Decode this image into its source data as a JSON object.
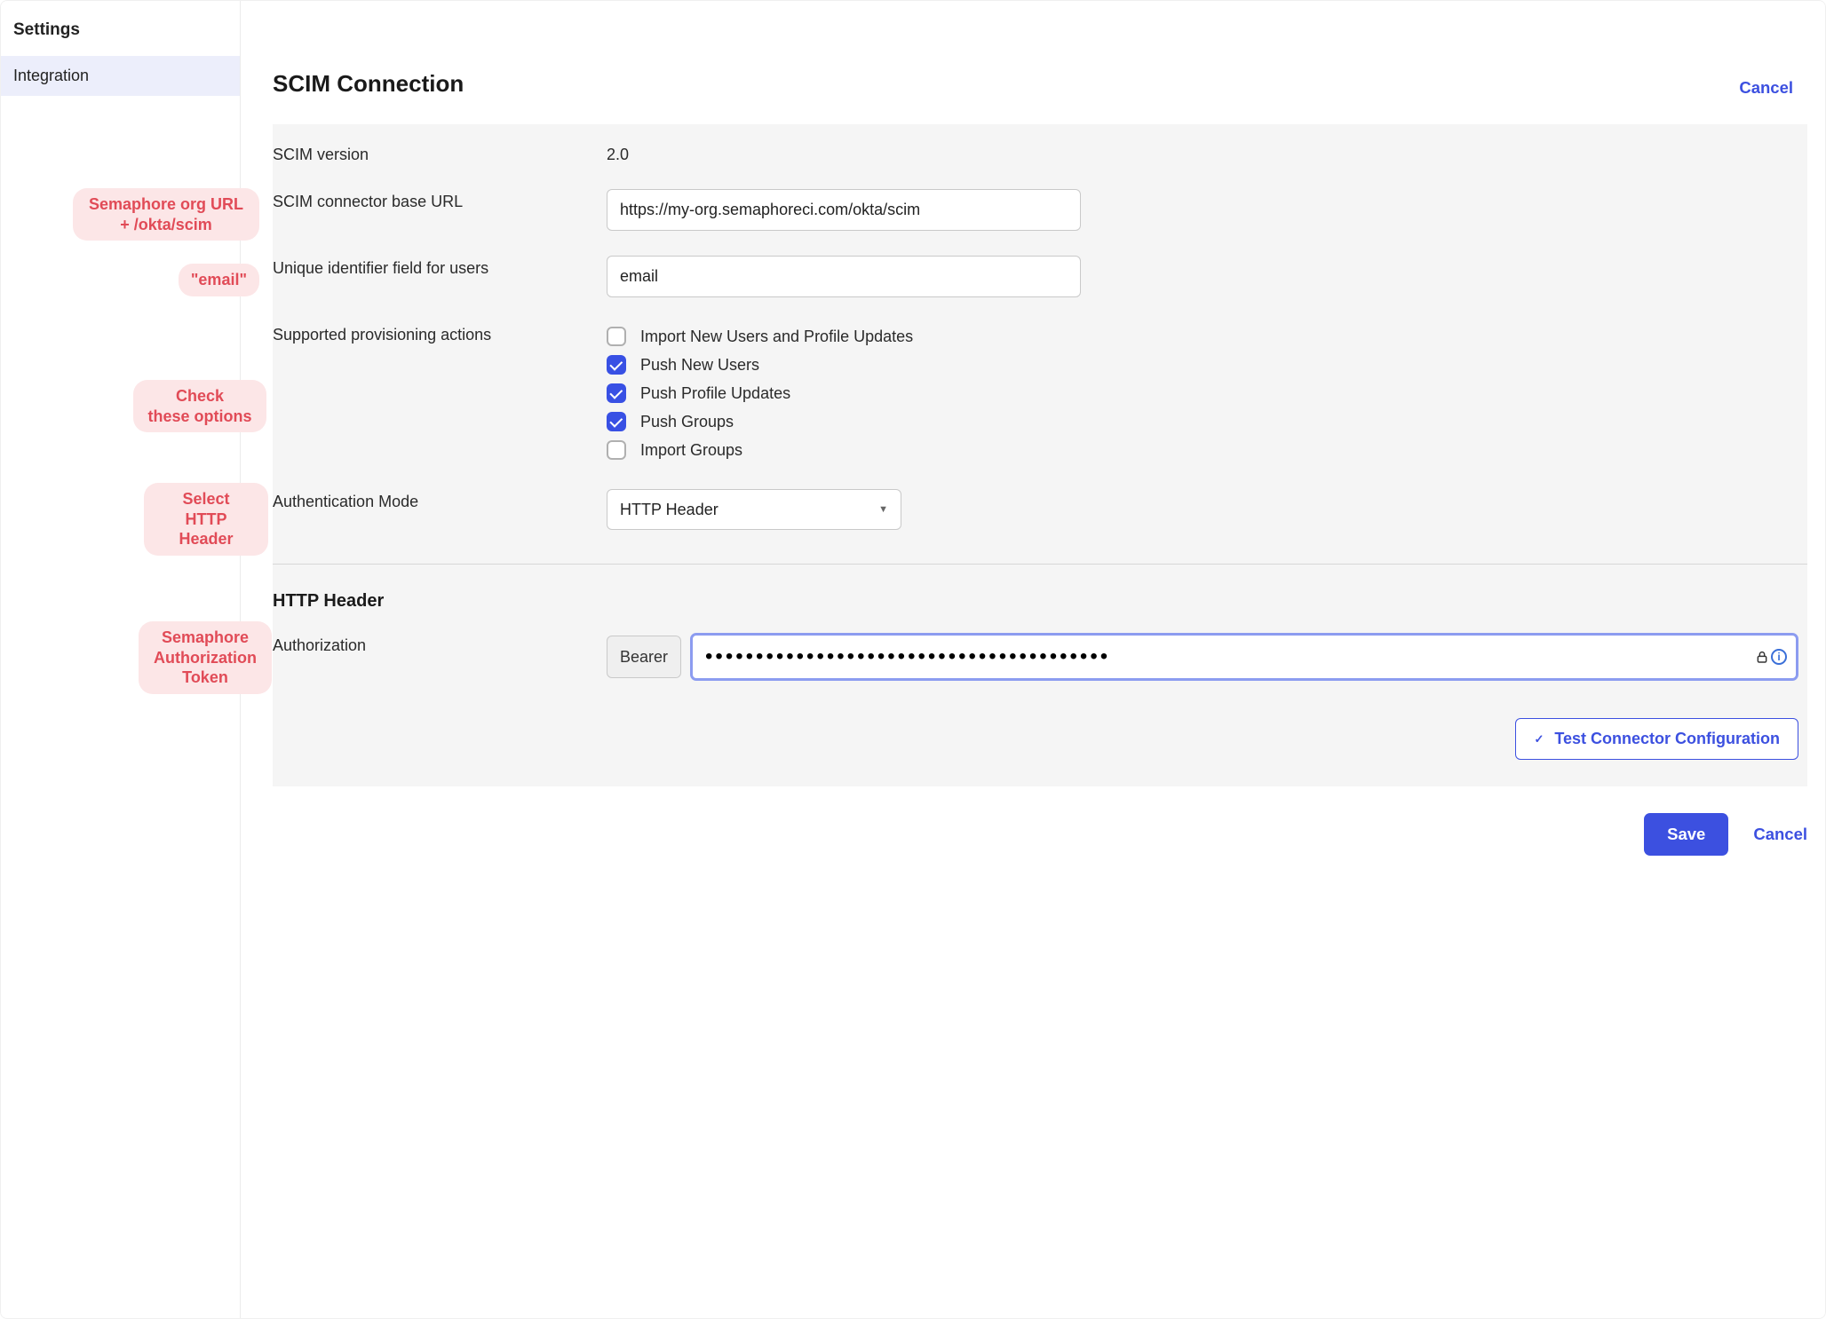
{
  "sidebar": {
    "header": "Settings",
    "item": "Integration"
  },
  "page": {
    "title": "SCIM Connection",
    "cancel": "Cancel"
  },
  "form": {
    "scim_version_label": "SCIM version",
    "scim_version_value": "2.0",
    "base_url_label": "SCIM connector base URL",
    "base_url_value": "https://my-org.semaphoreci.com/okta/scim",
    "uid_label": "Unique identifier field for users",
    "uid_value": "email",
    "provisioning_label": "Supported provisioning actions",
    "provisioning_actions": [
      {
        "label": "Import New Users and Profile Updates",
        "checked": false
      },
      {
        "label": "Push New Users",
        "checked": true
      },
      {
        "label": "Push Profile Updates",
        "checked": true
      },
      {
        "label": "Push Groups",
        "checked": true
      },
      {
        "label": "Import Groups",
        "checked": false
      }
    ],
    "auth_mode_label": "Authentication Mode",
    "auth_mode_value": "HTTP Header",
    "http_header_title": "HTTP Header",
    "authorization_label": "Authorization",
    "bearer_label": "Bearer",
    "token_value": "••••••••••••••••••••••••••••••••••••••••",
    "test_btn": "Test Connector Configuration"
  },
  "footer": {
    "save": "Save",
    "cancel": "Cancel"
  },
  "callouts": {
    "base_url": "Semaphore org URL\n+ /okta/scim",
    "email": "\"email\"",
    "check": "Check\nthese options",
    "header": "Select\nHTTP Header",
    "token": "Semaphore\nAuthorization\nToken"
  }
}
